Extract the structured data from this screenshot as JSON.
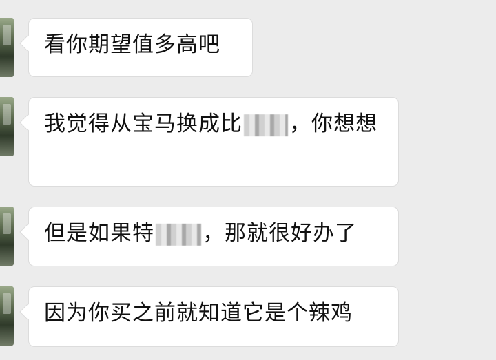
{
  "messages": [
    {
      "text": "看你期望值多高吧"
    },
    {
      "before": "我觉得从宝马换成比",
      "after": "，你想想"
    },
    {
      "before": "但是如果特",
      "after": "，那就很好办了"
    },
    {
      "text": "因为你买之前就知道它是个辣鸡"
    }
  ],
  "colors": {
    "background": "#ececec",
    "bubble": "#ffffff",
    "text": "#111111"
  }
}
